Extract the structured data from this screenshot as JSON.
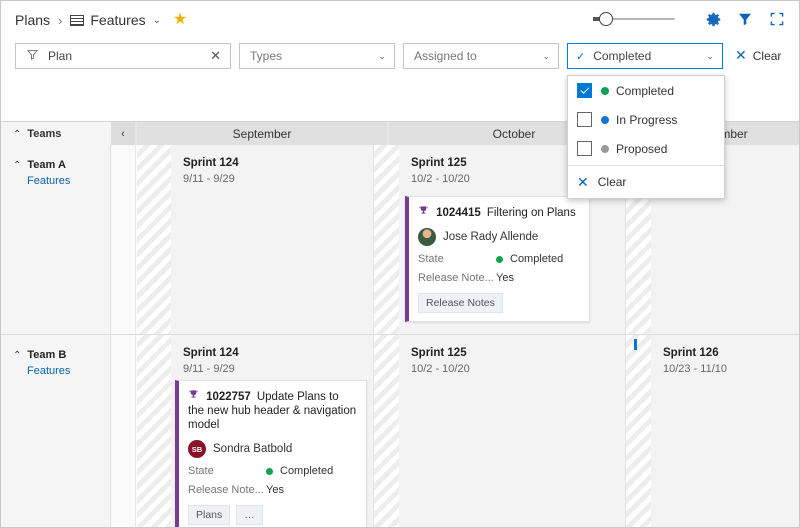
{
  "header": {
    "breadcrumb_root": "Plans",
    "breadcrumb_sep": "›",
    "breadcrumb_current": "Features",
    "chevron": "⌄",
    "star": "★",
    "icons": {
      "gear": "gear-icon",
      "filter": "filter-icon",
      "fullscreen": "fullscreen-icon"
    }
  },
  "filters": {
    "plan": {
      "value": "Plan",
      "clear": "✕"
    },
    "types": {
      "value": "Types",
      "chevron": "⌄"
    },
    "assigned_to": {
      "value": "Assigned to",
      "chevron": "⌄"
    },
    "state": {
      "value": "Completed",
      "check": "✓",
      "chevron": "⌄"
    },
    "clear_all": {
      "label": "Clear",
      "icon": "✕"
    }
  },
  "dropdown": {
    "options": [
      {
        "label": "Completed",
        "checked": true,
        "color": "#12a150"
      },
      {
        "label": "In Progress",
        "checked": false,
        "color": "#0f75d4"
      },
      {
        "label": "Proposed",
        "checked": false,
        "color": "#9a9a9a"
      }
    ],
    "clear": {
      "label": "Clear",
      "icon": "✕"
    }
  },
  "timeline": {
    "teams_header": "Teams",
    "teams_chevron": "⌃",
    "collapse_icon": "‹",
    "months": [
      "September",
      "October",
      "November"
    ]
  },
  "rows": [
    {
      "team": "Team A",
      "backlog": "Features",
      "chevron": "⌃",
      "sprints": [
        {
          "name": "Sprint 124",
          "dates": "9/11 - 9/29"
        },
        {
          "name": "Sprint 125",
          "dates": "10/2 - 10/20"
        }
      ],
      "cards": [
        {
          "id": "1024415",
          "title": "Filtering on Plans",
          "assignee": "Jose Rady Allende",
          "avatar_initials": "",
          "fields": [
            {
              "name": "State",
              "value": "Completed",
              "color": "#12a150"
            },
            {
              "name": "Release Note...",
              "value": "Yes",
              "color": ""
            }
          ],
          "tags": [
            "Release Notes"
          ]
        }
      ]
    },
    {
      "team": "Team B",
      "backlog": "Features",
      "chevron": "⌃",
      "sprints": [
        {
          "name": "Sprint 124",
          "dates": "9/11 - 9/29"
        },
        {
          "name": "Sprint 125",
          "dates": "10/2 - 10/20"
        },
        {
          "name": "Sprint 126",
          "dates": "10/23 - 11/10"
        }
      ],
      "cards": [
        {
          "id": "1022757",
          "title": "Update Plans to the new hub header & navigation model",
          "assignee": "Sondra Batbold",
          "avatar_initials": "SB",
          "fields": [
            {
              "name": "State",
              "value": "Completed",
              "color": "#12a150"
            },
            {
              "name": "Release Note...",
              "value": "Yes",
              "color": ""
            }
          ],
          "tags": [
            "Plans",
            "…"
          ]
        }
      ]
    }
  ],
  "colors": {
    "accent": "#0078d4",
    "link": "#0b62ad",
    "card_border": "#773b93",
    "completed": "#12a150",
    "in_progress": "#0f75d4",
    "proposed": "#9a9a9a",
    "star": "#f0b000"
  }
}
